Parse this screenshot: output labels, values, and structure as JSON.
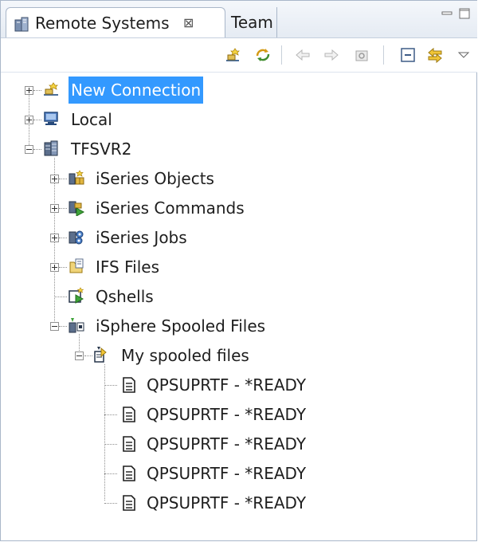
{
  "tabs": [
    {
      "label": "Remote Systems",
      "close": "⊠",
      "active": true
    },
    {
      "label": "Team",
      "active": false
    }
  ],
  "toolbar": {
    "buttons": [
      "new-connection-icon",
      "refresh-icon",
      "back-icon",
      "forward-icon",
      "home-icon",
      "collapse-all-icon",
      "link-with-editor-icon",
      "view-menu-icon"
    ]
  },
  "tree": {
    "new_connection": "New Connection",
    "local": "Local",
    "server": "TFSVR2",
    "iseries_objects": "iSeries Objects",
    "iseries_commands": "iSeries Commands",
    "iseries_jobs": "iSeries Jobs",
    "ifs_files": "IFS Files",
    "qshells": "Qshells",
    "isphere_spooled_files": "iSphere Spooled Files",
    "my_spooled_files": "My spooled files",
    "spooled_files": [
      "QPSUPRTF - *READY",
      "QPSUPRTF - *READY",
      "QPSUPRTF - *READY",
      "QPSUPRTF - *READY",
      "QPSUPRTF - *READY"
    ]
  },
  "colors": {
    "selection": "#3399ff",
    "frame": "#a9b7c9"
  }
}
